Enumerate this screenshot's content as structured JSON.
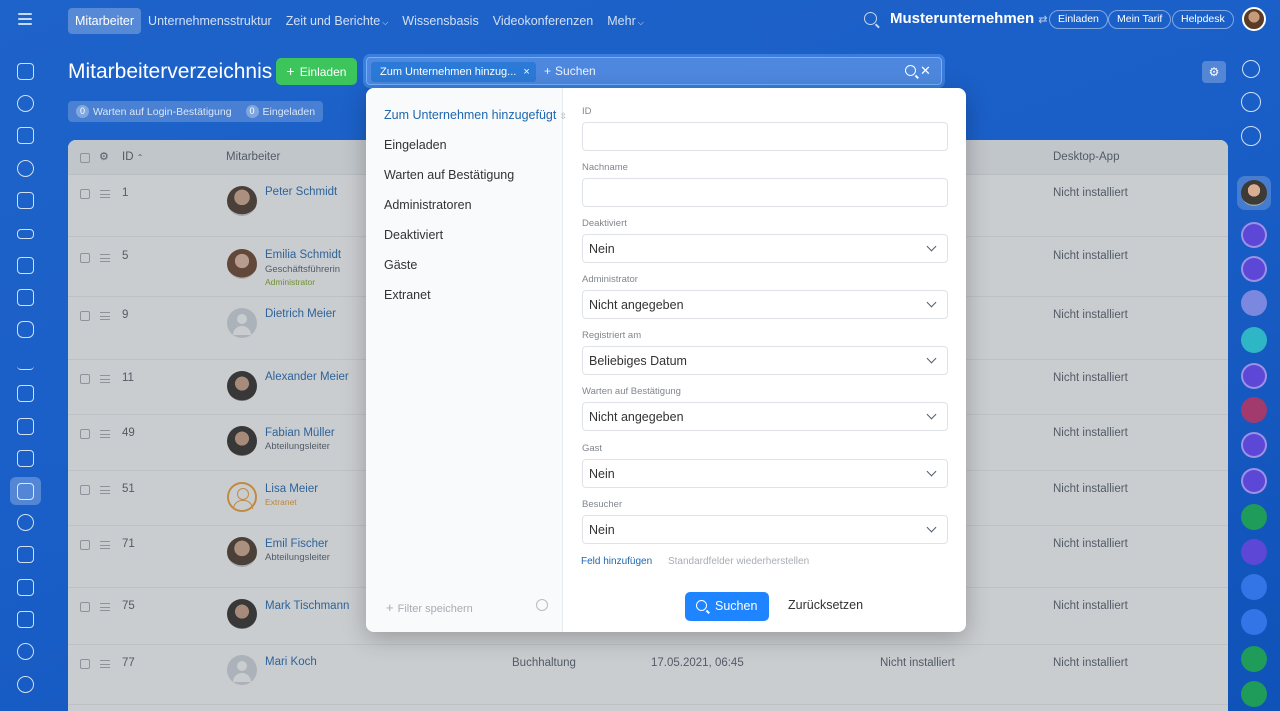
{
  "topnav": {
    "items": [
      {
        "label": "Mitarbeiter"
      },
      {
        "label": "Unternehmensstruktur"
      },
      {
        "label": "Zeit und Berichte"
      },
      {
        "label": "Wissensbasis"
      },
      {
        "label": "Videokonferenzen"
      },
      {
        "label": "Mehr"
      }
    ],
    "company": "Musterunternehmen",
    "invite": "Einladen",
    "tariff": "Mein Tarif",
    "helpdesk": "Helpdesk"
  },
  "page": {
    "title": "Mitarbeiterverzeichnis",
    "invite_button": "Einladen",
    "search_tag": "Zum Unternehmen hinzug...",
    "search_placeholder": "Suchen",
    "pending_count": "0",
    "pending_label": "Warten auf Login-Bestätigung",
    "invited_count": "0",
    "invited_label": "Eingeladen"
  },
  "table": {
    "headers": {
      "id": "ID",
      "employee": "Mitarbeiter",
      "desktop": "Desktop-App"
    },
    "rows": [
      {
        "id": "1",
        "name": "Peter Schmidt",
        "sub": "",
        "badge": "",
        "desktop": "Nicht installiert"
      },
      {
        "id": "5",
        "name": "Emilia Schmidt",
        "sub": "Geschäftsführerin",
        "badge": "Administrator",
        "desktop": "Nicht installiert"
      },
      {
        "id": "9",
        "name": "Dietrich Meier",
        "sub": "",
        "badge": "",
        "desktop": "Nicht installiert"
      },
      {
        "id": "11",
        "name": "Alexander Meier",
        "sub": "",
        "badge": "",
        "desktop": "Nicht installiert"
      },
      {
        "id": "49",
        "name": "Fabian Müller",
        "sub": "Abteilungsleiter",
        "badge": "",
        "desktop": "Nicht installiert"
      },
      {
        "id": "51",
        "name": "Lisa Meier",
        "sub": "",
        "badge": "Extranet",
        "desktop": "Nicht installiert"
      },
      {
        "id": "71",
        "name": "Emil Fischer",
        "sub": "Abteilungsleiter",
        "badge": "",
        "desktop": "Nicht installiert"
      },
      {
        "id": "75",
        "name": "Mark Tischmann",
        "sub": "",
        "badge": "",
        "desktop": "Nicht installiert"
      },
      {
        "id": "77",
        "name": "Mari Koch",
        "sub": "",
        "badge": "",
        "department": "Buchhaltung",
        "date": "17.05.2021, 06:45",
        "mobile": "Nicht installiert",
        "desktop": "Nicht installiert"
      }
    ]
  },
  "filter": {
    "presets": [
      {
        "label": "Zum Unternehmen hinzugefügt"
      },
      {
        "label": "Eingeladen"
      },
      {
        "label": "Warten auf Bestätigung"
      },
      {
        "label": "Administratoren"
      },
      {
        "label": "Deaktiviert"
      },
      {
        "label": "Gäste"
      },
      {
        "label": "Extranet"
      }
    ],
    "save_filter": "Filter speichern",
    "fields": [
      {
        "label": "ID",
        "value": ""
      },
      {
        "label": "Nachname",
        "value": ""
      },
      {
        "label": "Deaktiviert",
        "value": "Nein"
      },
      {
        "label": "Administrator",
        "value": "Nicht angegeben"
      },
      {
        "label": "Registriert am",
        "value": "Beliebiges Datum"
      },
      {
        "label": "Warten auf Bestätigung",
        "value": "Nicht angegeben"
      },
      {
        "label": "Gast",
        "value": "Nein"
      },
      {
        "label": "Besucher",
        "value": "Nein"
      }
    ],
    "add_field": "Feld hinzufügen",
    "restore_fields": "Standardfelder wiederherstellen",
    "search_button": "Suchen",
    "reset_button": "Zurücksetzen"
  },
  "colors": {
    "accent": "#1f84ff",
    "invite_green": "#3bc55a",
    "link": "#2067b0"
  }
}
